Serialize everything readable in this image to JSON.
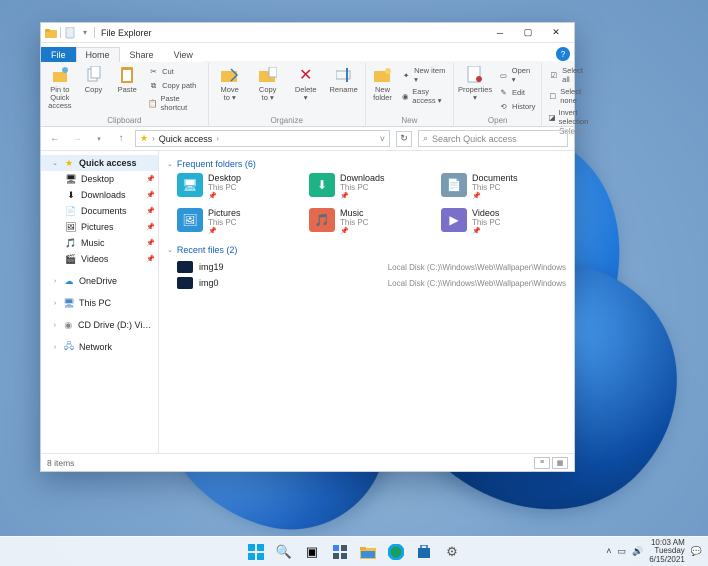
{
  "titlebar": {
    "title": "File Explorer"
  },
  "tabs": {
    "file": "File",
    "home": "Home",
    "share": "Share",
    "view": "View"
  },
  "ribbon": {
    "clipboard": {
      "label": "Clipboard",
      "pin": "Pin to Quick\naccess",
      "copy": "Copy",
      "paste": "Paste",
      "cut": "Cut",
      "copy_path": "Copy path",
      "paste_shortcut": "Paste shortcut"
    },
    "organize": {
      "label": "Organize",
      "move_to": "Move\nto ▾",
      "copy_to": "Copy\nto ▾",
      "delete": "Delete\n▾",
      "rename": "Rename"
    },
    "new": {
      "label": "New",
      "new_folder": "New\nfolder",
      "new_item": "New item ▾",
      "easy_access": "Easy access ▾"
    },
    "open": {
      "label": "Open",
      "properties": "Properties\n▾",
      "open": "Open ▾",
      "edit": "Edit",
      "history": "History"
    },
    "select": {
      "label": "Select",
      "select_all": "Select all",
      "select_none": "Select none",
      "invert": "Invert selection"
    }
  },
  "addr": {
    "location": "Quick access",
    "search_placeholder": "Search Quick access"
  },
  "sidebar": {
    "quick_access": "Quick access",
    "items": [
      "Desktop",
      "Downloads",
      "Documents",
      "Pictures",
      "Music",
      "Videos"
    ],
    "onedrive": "OneDrive",
    "thispc": "This PC",
    "cd": "CD Drive (D:) VirtualE",
    "network": "Network"
  },
  "main": {
    "freq_hdr": "Frequent folders (6)",
    "folders": [
      {
        "name": "Desktop",
        "sub": "This PC",
        "color": "#25b0d3"
      },
      {
        "name": "Downloads",
        "sub": "This PC",
        "color": "#1db386"
      },
      {
        "name": "Documents",
        "sub": "This PC",
        "color": "#7c9bb0"
      },
      {
        "name": "Pictures",
        "sub": "This PC",
        "color": "#2e95d6"
      },
      {
        "name": "Music",
        "sub": "This PC",
        "color": "#e4694e"
      },
      {
        "name": "Videos",
        "sub": "This PC",
        "color": "#7a6fc9"
      }
    ],
    "recent_hdr": "Recent files (2)",
    "recent": [
      {
        "name": "img19",
        "path": "Local Disk (C:)\\Windows\\Web\\Wallpaper\\Windows"
      },
      {
        "name": "img0",
        "path": "Local Disk (C:)\\Windows\\Web\\Wallpaper\\Windows"
      }
    ]
  },
  "status": {
    "count": "8 items"
  },
  "tray": {
    "time": "10:03 AM",
    "day": "Tuesday",
    "date": "6/15/2021"
  }
}
